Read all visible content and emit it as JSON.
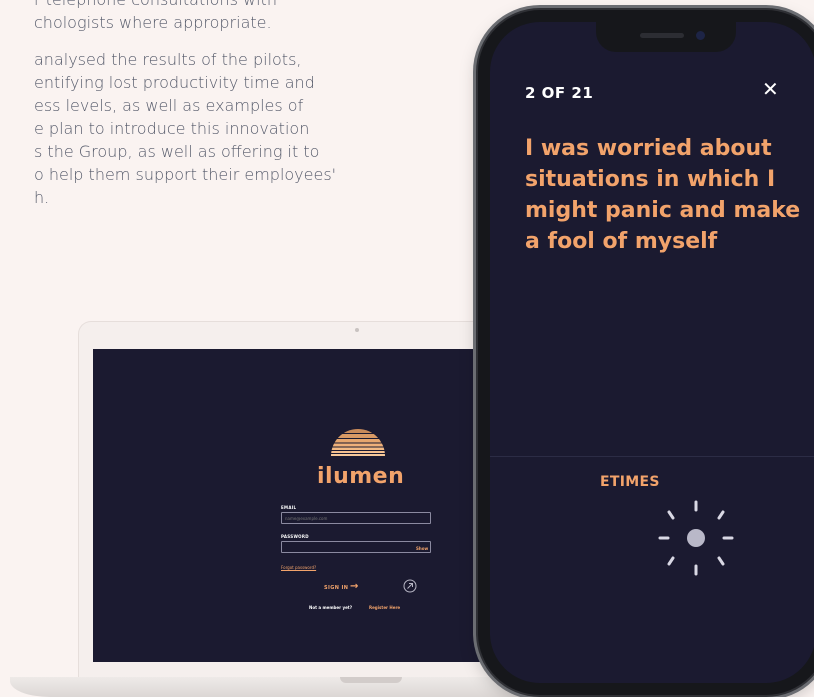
{
  "article": {
    "lines": [
      "r telephone consultations with",
      "chologists where appropriate.",
      "",
      "analysed the results of the pilots,",
      "entifying lost productivity time and",
      "ess levels, as well as examples of",
      "e plan to introduce this innovation",
      "s the Group, as well as offering it to",
      "o help them support their employees'",
      "h."
    ]
  },
  "phone": {
    "counter": "2 OF 21",
    "close_glyph": "✕",
    "question_lines": [
      "I was worried about",
      "situations in which I",
      "might panic and make",
      "a fool of myself"
    ],
    "answer_label": "ETIMES",
    "colors": {
      "screen_bg": "#1b1a30",
      "accent": "#f2a36b"
    }
  },
  "laptop": {
    "brand": "ilumen",
    "email_label": "EMAIL",
    "email_placeholder": "name@example.com",
    "password_label": "PASSWORD",
    "password_value": "",
    "show_label": "Show",
    "forgot_label": "Forgot password?",
    "signin_label": "SIGN IN",
    "signin_arrow": "→",
    "not_member_label": "Not a member yet?",
    "register_label": "Register Here",
    "colors": {
      "screen_bg": "#1b1a30",
      "accent": "#f2a36b",
      "bezel": "#f5efed"
    }
  },
  "icons": {
    "logo": "sunset-logo-icon",
    "close": "close-icon",
    "dial": "slider-dial-icon",
    "arrow": "arrow-right-icon",
    "accessibility": "accessibility-icon"
  }
}
